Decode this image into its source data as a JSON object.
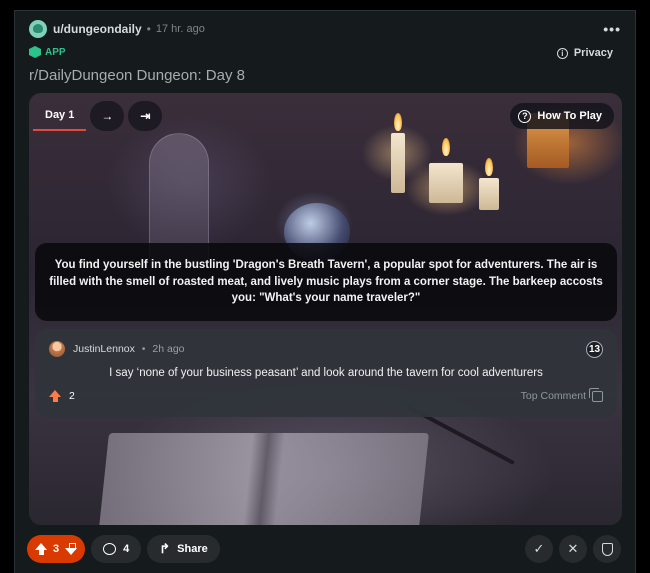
{
  "post": {
    "username": "u/dungeondaily",
    "separator": "•",
    "time": "17 hr. ago",
    "more_icon": "•••",
    "app_label": "APP",
    "privacy_label": "Privacy",
    "title": "r/DailyDungeon Dungeon: Day 8"
  },
  "game": {
    "tabs": [
      {
        "label": "Day 1",
        "active": true
      }
    ],
    "next_icon": "→",
    "last_icon": "⇥",
    "how_to_play": "How To Play",
    "help_icon": "?",
    "story": "You find yourself in the bustling 'Dragon's Breath Tavern', a popular spot for adventurers. The air is filled with the smell of roasted meat, and lively music plays from a corner stage. The barkeep accosts you: \"What's your name traveler?\"",
    "comment": {
      "user": "JustinLennox",
      "dot": "•",
      "time": "2h ago",
      "badge": "13",
      "text": "I say ‘none of your business peasant’ and look around the tavern for cool adventurers",
      "votes": "2",
      "top_label": "Top Comment"
    }
  },
  "actions": {
    "score": "3",
    "comments": "4",
    "share": "Share",
    "approve_icon": "✓",
    "remove_icon": "✕"
  },
  "colors": {
    "accent": "#d93a00",
    "app_green": "#2cc38a",
    "tab_underline": "#e34b3c",
    "upvote_orange": "#ff7b4a"
  }
}
